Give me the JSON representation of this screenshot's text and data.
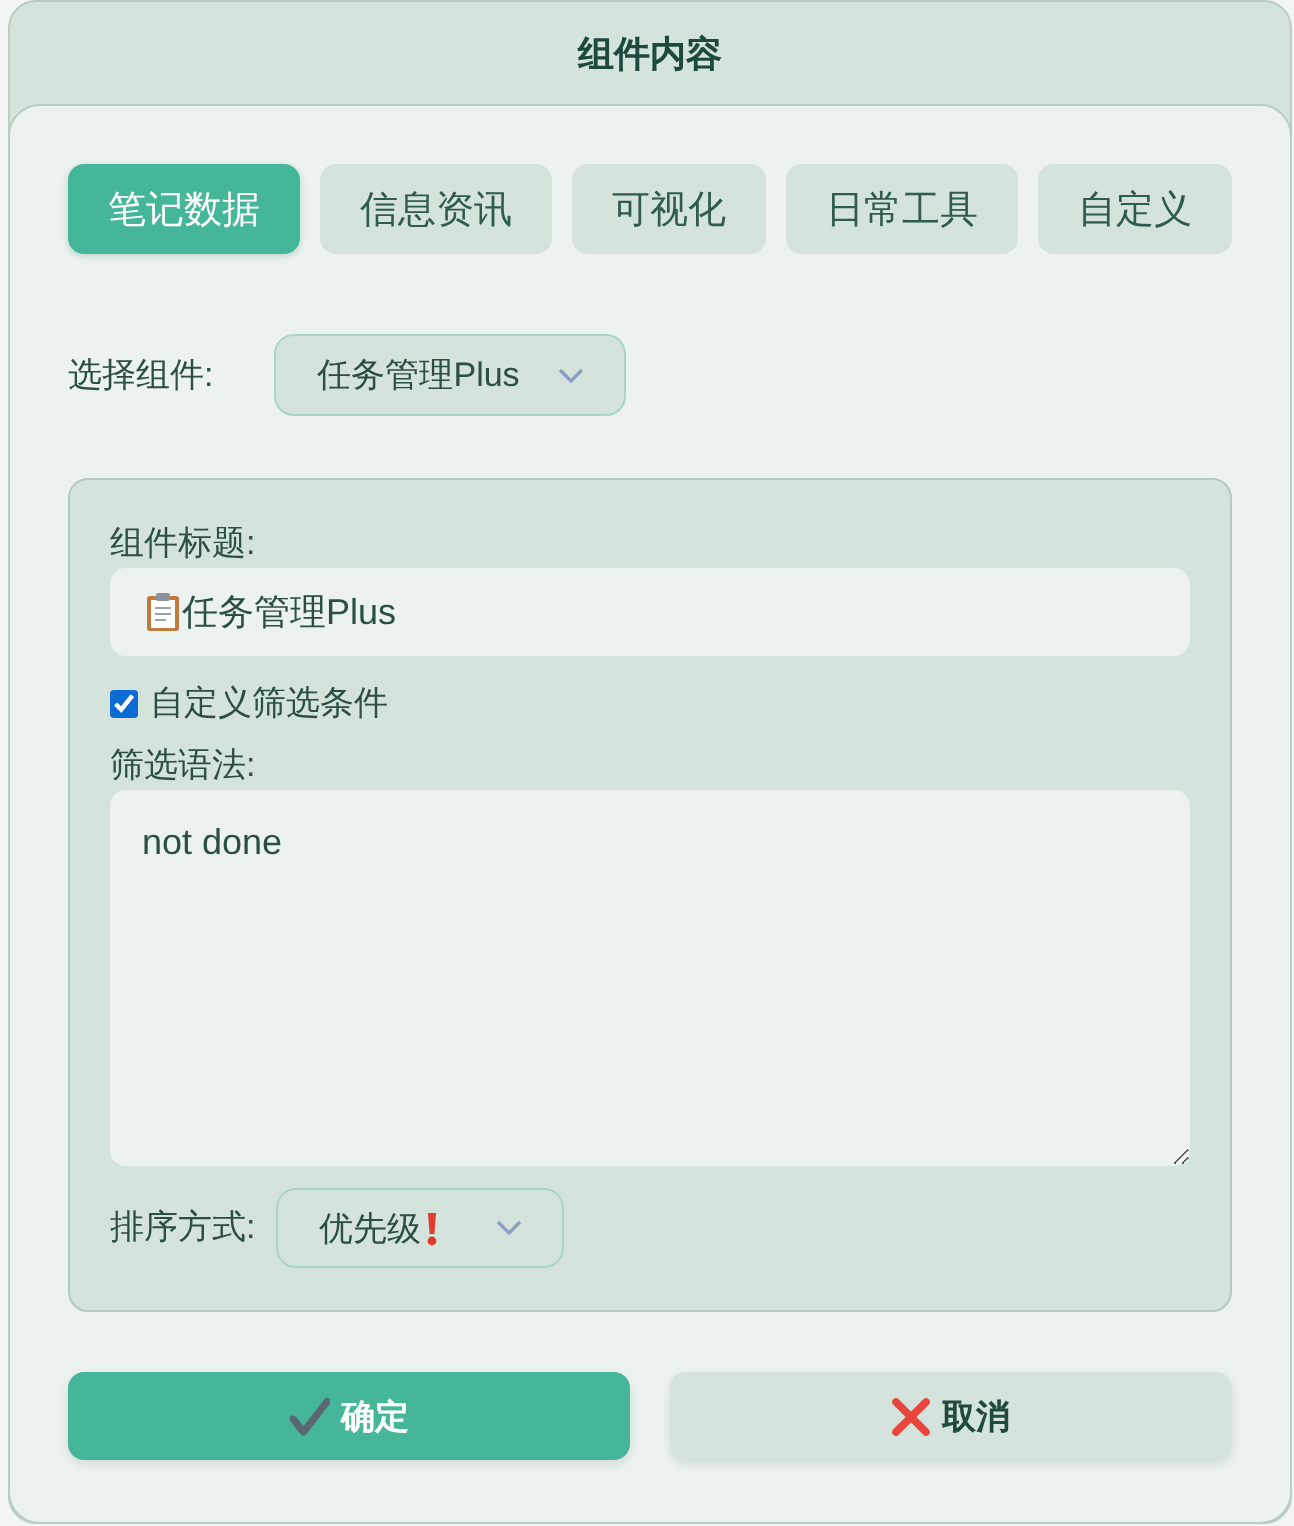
{
  "dialog": {
    "title": "组件内容"
  },
  "tabs": [
    {
      "label": "笔记数据",
      "selected": true
    },
    {
      "label": "信息资讯",
      "selected": false
    },
    {
      "label": "可视化",
      "selected": false
    },
    {
      "label": "日常工具",
      "selected": false
    },
    {
      "label": "自定义",
      "selected": false
    }
  ],
  "component_select": {
    "label": "选择组件:",
    "value": "任务管理Plus"
  },
  "settings": {
    "title_field": {
      "label": "组件标题:",
      "value": "任务管理Plus"
    },
    "custom_filter": {
      "label": "自定义筛选条件",
      "checked": true
    },
    "syntax_field": {
      "label": "筛选语法:",
      "value": "not done"
    },
    "sort_select": {
      "label": "排序方式:",
      "value": "优先级"
    }
  },
  "buttons": [
    {
      "kind": "confirm",
      "label": "确定"
    },
    {
      "kind": "cancel",
      "label": "取消"
    }
  ]
}
